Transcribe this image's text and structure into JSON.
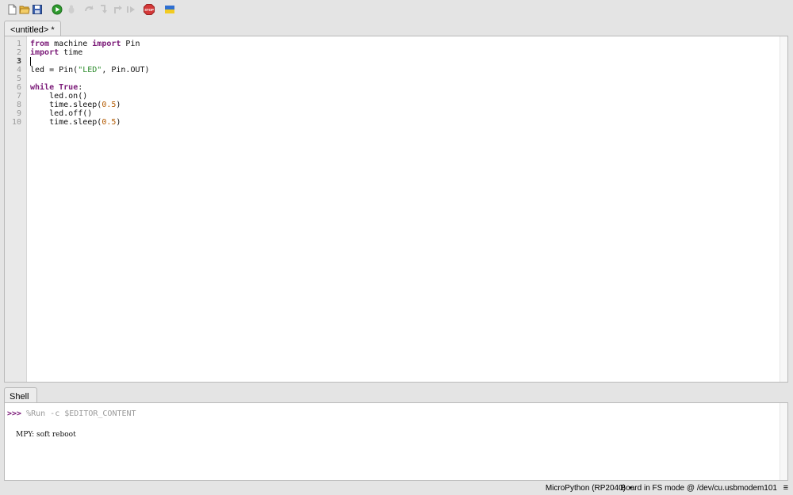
{
  "toolbar": {
    "buttons": [
      {
        "name": "new-file",
        "icon": "new-file-icon",
        "enabled": true
      },
      {
        "name": "open-file",
        "icon": "folder-open-icon",
        "enabled": true
      },
      {
        "name": "save-file",
        "icon": "floppy-disk-icon",
        "enabled": true
      },
      {
        "name": "run",
        "icon": "play-icon",
        "enabled": true
      },
      {
        "name": "debug",
        "icon": "bug-icon",
        "enabled": false
      },
      {
        "name": "step-over",
        "icon": "step-over-icon",
        "enabled": false
      },
      {
        "name": "step-into",
        "icon": "step-into-icon",
        "enabled": false
      },
      {
        "name": "step-out",
        "icon": "step-out-icon",
        "enabled": false
      },
      {
        "name": "resume",
        "icon": "resume-icon",
        "enabled": false
      },
      {
        "name": "stop",
        "icon": "stop-icon",
        "enabled": true,
        "label": "STOP"
      },
      {
        "name": "support-ukraine",
        "icon": "ukraine-flag-icon",
        "enabled": true
      }
    ],
    "colors": {
      "run": "#2e9a2e",
      "stop": "#d43838",
      "flag_top": "#2f6fd1",
      "flag_bottom": "#f2cb22"
    }
  },
  "editor": {
    "tab_label": "<untitled> *",
    "current_line": 3,
    "line_numbers": [
      "1",
      "2",
      "3",
      "4",
      "5",
      "6",
      "7",
      "8",
      "9",
      "10"
    ]
  },
  "shell": {
    "tab_label": "Shell",
    "prompt": ">>>",
    "command": " %Run -c $EDITOR_CONTENT",
    "output": "MPY: soft reboot"
  },
  "status_bar": {
    "interpreter": "MicroPython (RP2040)",
    "separator": "•",
    "board_info": "Board in FS mode @ /dev/cu.usbmodem101",
    "menu_glyph": "≡"
  },
  "colors": {
    "keyword": "#7b1a78",
    "string": "#2a8a2a",
    "number": "#b35a00"
  }
}
